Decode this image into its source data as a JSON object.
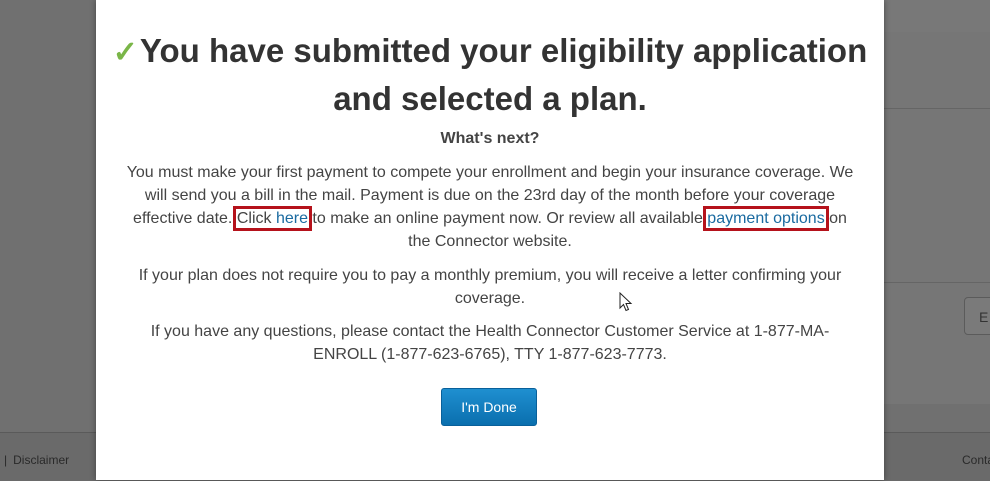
{
  "modal": {
    "title": "You have submitted your eligibility application and selected a plan.",
    "title_icon": "checkmark-icon",
    "subtitle": "What's next?",
    "para1_before": "You must make your first payment to compete your enrollment and begin your insurance coverage. We will send you a bill in the mail. Payment is due on the 23rd day of the month before your coverage effective date. ",
    "click_text": "Click ",
    "here_link": "here",
    "para1_mid": " to make an online payment now. Or review all available ",
    "payment_options_link": "payment options",
    "para1_after": " on the Connector website.",
    "para2": "If your plan does not require you to pay a monthly premium, you will receive a letter confirming your coverage.",
    "para3": "If you have any questions, please contact the Health Connector Customer Service at 1-877-MA-ENROLL (1-877-623-6765), TTY 1-877-623-7773.",
    "done_button": "I'm Done"
  },
  "background": {
    "footer_separator": "|",
    "footer_left": "Disclaimer",
    "footer_right": "Conta",
    "right_button": "E"
  },
  "colors": {
    "check": "#7ab648",
    "link": "#1a6aa0",
    "highlight_box": "#b5121b",
    "button": "#0a6fae"
  }
}
